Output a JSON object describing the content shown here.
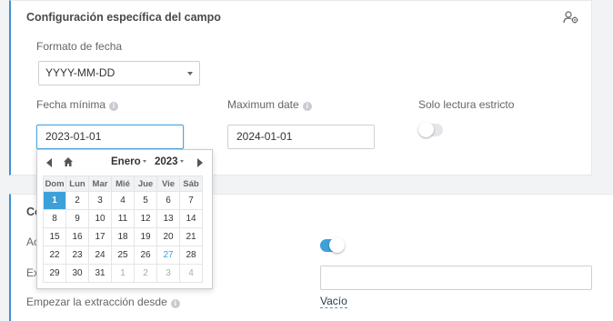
{
  "section1": {
    "title": "Configuración específica del campo",
    "date_format_label": "Formato de fecha",
    "date_format_value": "YYYY-MM-DD",
    "min_date_label": "Fecha mínima",
    "min_date_value": "2023-01-01",
    "max_date_label": "Maximum date",
    "max_date_value": "2024-01-01",
    "readonly_label": "Solo lectura estricto",
    "readonly_on": false
  },
  "section2": {
    "title_partial": "Co",
    "row1_label_partial": "Ac",
    "row2_label_partial": "Ex",
    "row3_label": "Empezar la extracción desde",
    "toggle_on": true,
    "vacio": "Vacío"
  },
  "datepicker": {
    "month": "Enero",
    "year": "2023",
    "weekdays": [
      "Dom",
      "Lun",
      "Mar",
      "Mié",
      "Jue",
      "Vie",
      "Sáb"
    ],
    "weeks": [
      [
        "1",
        "2",
        "3",
        "4",
        "5",
        "6",
        "7"
      ],
      [
        "8",
        "9",
        "10",
        "11",
        "12",
        "13",
        "14"
      ],
      [
        "15",
        "16",
        "17",
        "18",
        "19",
        "20",
        "21"
      ],
      [
        "22",
        "23",
        "24",
        "25",
        "26",
        "27",
        "28"
      ],
      [
        "29",
        "30",
        "31",
        "1",
        "2",
        "3",
        "4"
      ]
    ],
    "selected_day": "1",
    "today_day": "27",
    "colors": {
      "accent": "#3ca1d9",
      "header_bg": "#f1f2f4"
    }
  },
  "icons": {
    "settings": "user-gear-icon",
    "info": "info-icon",
    "home": "home-icon",
    "prev": "prev-arrow-icon",
    "next": "next-arrow-icon"
  }
}
